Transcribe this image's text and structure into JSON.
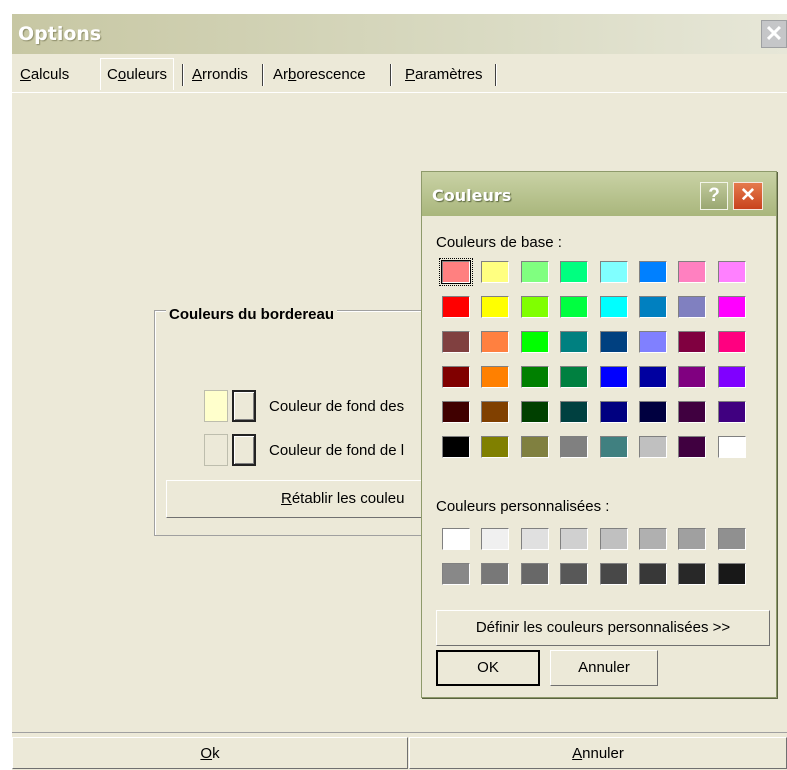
{
  "options": {
    "title": "Options",
    "close_glyph": "✕",
    "tabs": [
      {
        "pre": "",
        "u": "C",
        "post": "alculs"
      },
      {
        "pre": "C",
        "u": "o",
        "post": "uleurs"
      },
      {
        "pre": "",
        "u": "A",
        "post": "rrondis"
      },
      {
        "pre": "Ar",
        "u": "b",
        "post": "orescence"
      },
      {
        "pre": "",
        "u": "P",
        "post": "aramètres"
      }
    ],
    "active_tab": 1,
    "group": {
      "title": "Couleurs du bordereau",
      "row1_label": "Couleur de fond des",
      "row2_label": "Couleur de fond de l",
      "row1_color": "#ffffcc",
      "row2_color": "#ece9d8",
      "reset_pre": "",
      "reset_u": "R",
      "reset_post": "établir les couleu"
    },
    "footer": {
      "ok_u": "O",
      "ok_post": "k",
      "cancel_u": "A",
      "cancel_post": "nnuler"
    }
  },
  "dialog": {
    "title": "Couleurs",
    "help_glyph": "?",
    "close_glyph": "✕",
    "basic_label": "Couleurs de base :",
    "custom_label": "Couleurs personnalisées :",
    "define_button": "Définir les couleurs personnalisées >>",
    "ok_button": "OK",
    "cancel_button": "Annuler",
    "basic_colors": [
      [
        "#ff8080",
        "#ffff80",
        "#80ff80",
        "#00ff80",
        "#80ffff",
        "#0080ff",
        "#ff80c0",
        "#ff80ff"
      ],
      [
        "#ff0000",
        "#ffff00",
        "#80ff00",
        "#00ff40",
        "#00ffff",
        "#0080c0",
        "#8080c0",
        "#ff00ff"
      ],
      [
        "#804040",
        "#ff8040",
        "#00ff00",
        "#008080",
        "#004080",
        "#8080ff",
        "#800040",
        "#ff0080"
      ],
      [
        "#800000",
        "#ff8000",
        "#008000",
        "#008040",
        "#0000ff",
        "#0000a0",
        "#800080",
        "#8000ff"
      ],
      [
        "#400000",
        "#804000",
        "#004000",
        "#004040",
        "#000080",
        "#000040",
        "#400040",
        "#400080"
      ],
      [
        "#000000",
        "#808000",
        "#808040",
        "#808080",
        "#408080",
        "#c0c0c0",
        "#400040",
        "#ffffff"
      ]
    ],
    "selected_basic": [
      0,
      0
    ],
    "custom_colors": [
      [
        "#ffffff",
        "#f0f0f0",
        "#e0e0e0",
        "#d0d0d0",
        "#c0c0c0",
        "#b0b0b0",
        "#a0a0a0",
        "#909090"
      ],
      [
        "#888888",
        "#787878",
        "#686868",
        "#585858",
        "#484848",
        "#383838",
        "#282828",
        "#181818"
      ]
    ]
  }
}
